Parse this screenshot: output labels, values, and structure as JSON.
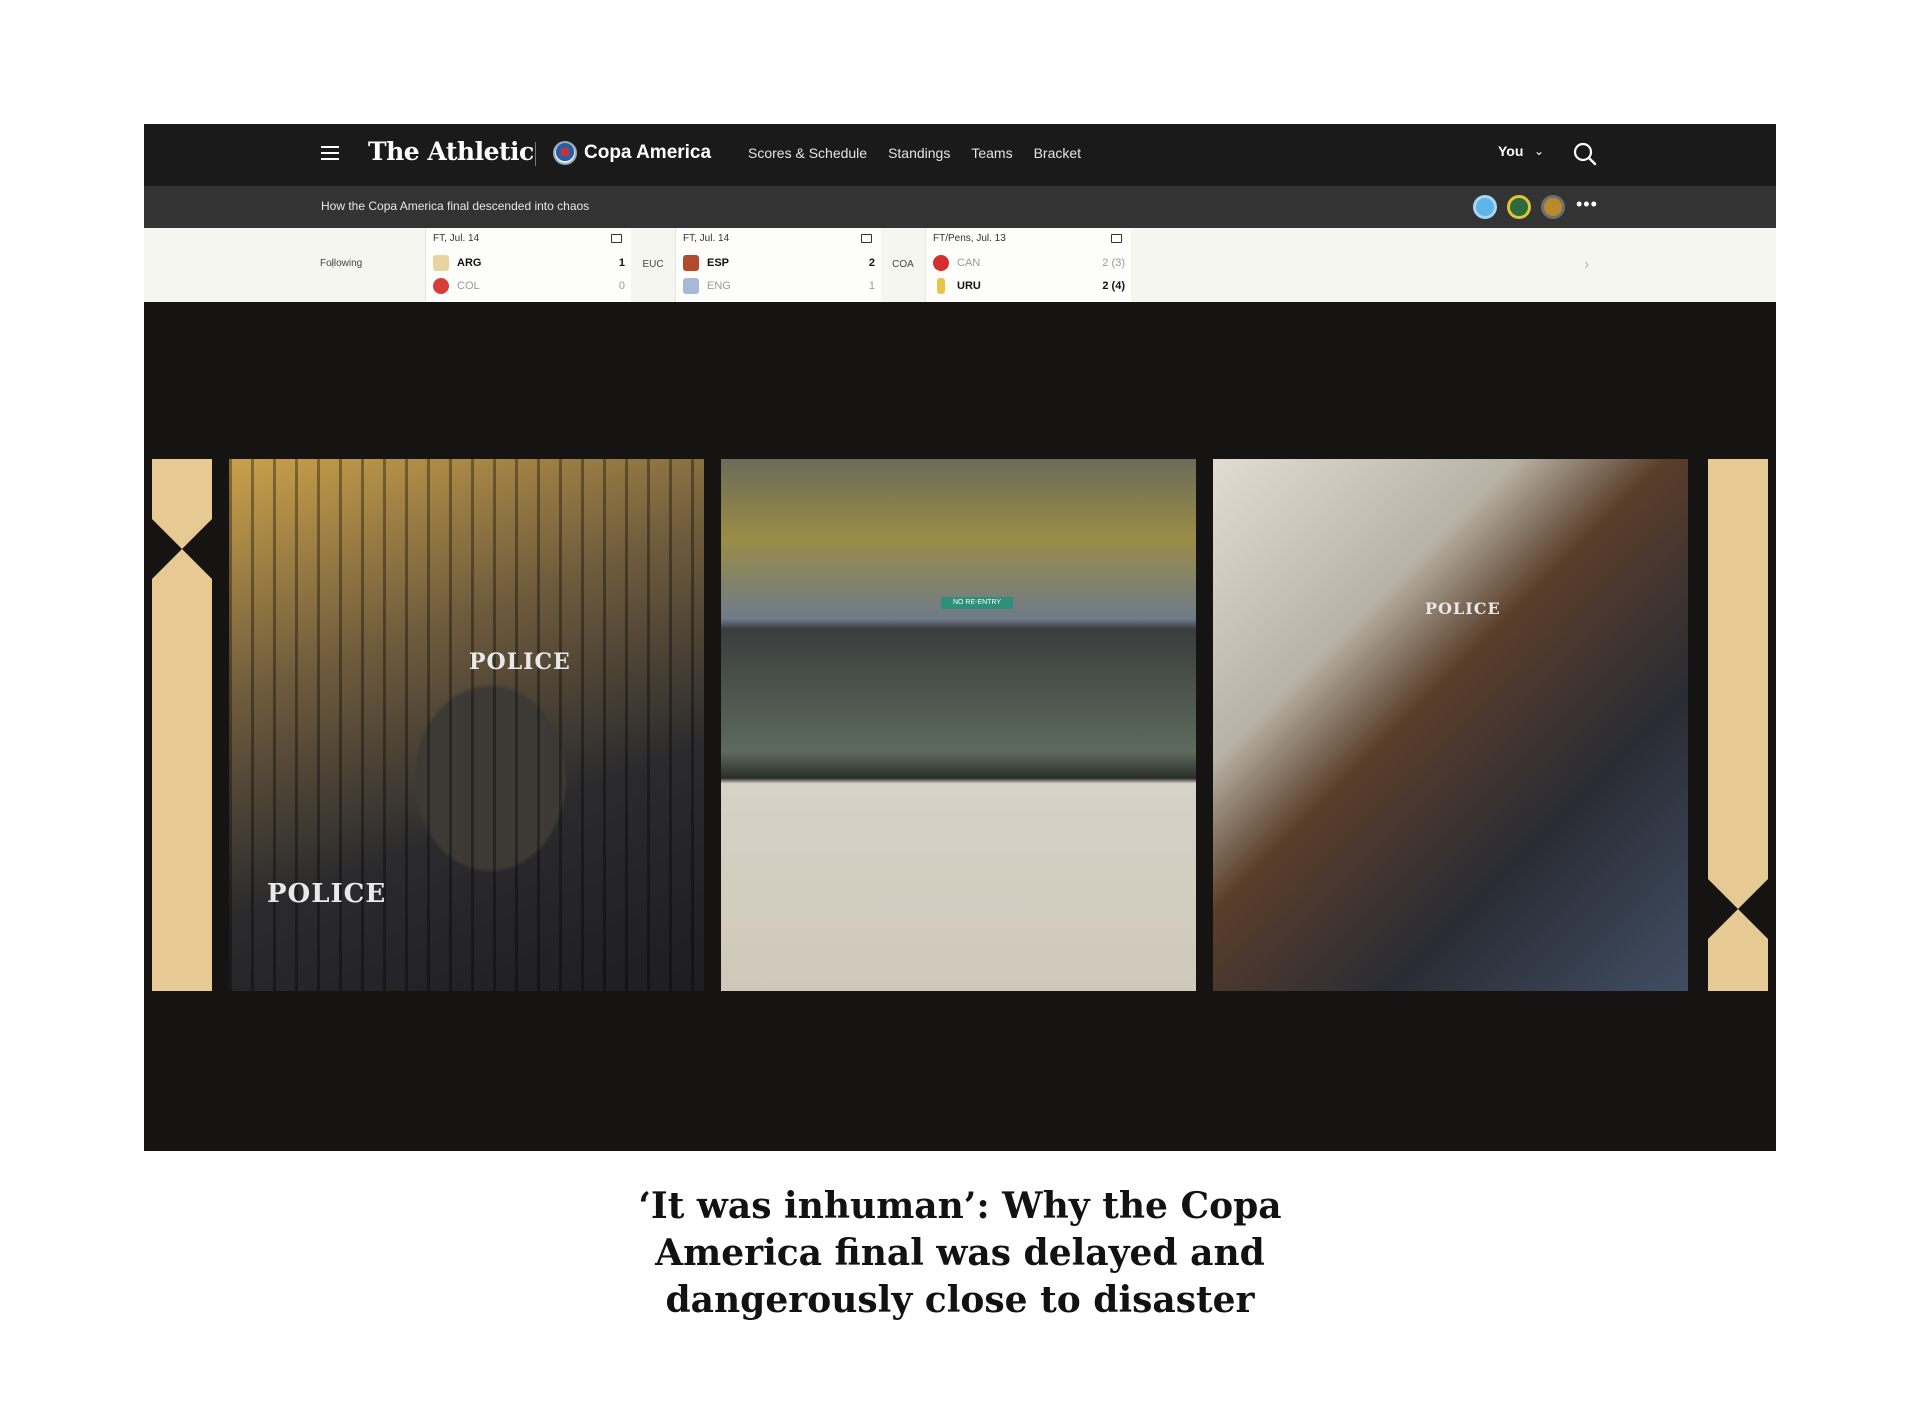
{
  "nav": {
    "brand": "The Athletic",
    "section": "Copa America",
    "links": [
      "Scores & Schedule",
      "Standings",
      "Teams",
      "Bracket"
    ],
    "user_label": "You"
  },
  "subbar": {
    "article_title": "How the Copa America final descended into chaos"
  },
  "scores": {
    "following_label": "Following",
    "games": [
      {
        "status": "FT, Jul. 14",
        "home": {
          "abbr": "ARG",
          "score": "1",
          "flag_color": "#e9d3a0"
        },
        "away": {
          "abbr": "COL",
          "score": "0",
          "flag_color": "#d93a3a"
        }
      },
      {
        "competition": "EUC",
        "status": "FT, Jul. 14",
        "home": {
          "abbr": "ESP",
          "score": "2",
          "flag_color": "#b24a2c"
        },
        "away": {
          "abbr": "ENG",
          "score": "1",
          "flag_color": "#a8b8d8"
        }
      },
      {
        "competition": "COA",
        "status": "FT/Pens, Jul. 13",
        "home": {
          "abbr": "CAN",
          "score": "2 (3)",
          "flag_color": "#d62e2e"
        },
        "away": {
          "abbr": "URU",
          "score": "2 (4)",
          "flag_color": "#e8c44a"
        }
      }
    ]
  },
  "hero": {
    "sign_text": "NO RE-ENTRY",
    "vest_text_1": "POLICE",
    "vest_text_2": "POLICE",
    "vest_text_3": "POLICE",
    "accent_color": "#e6c993"
  },
  "article": {
    "headline": "‘It was inhuman’: Why the Copa America final was delayed and dangerously close to disaster"
  }
}
